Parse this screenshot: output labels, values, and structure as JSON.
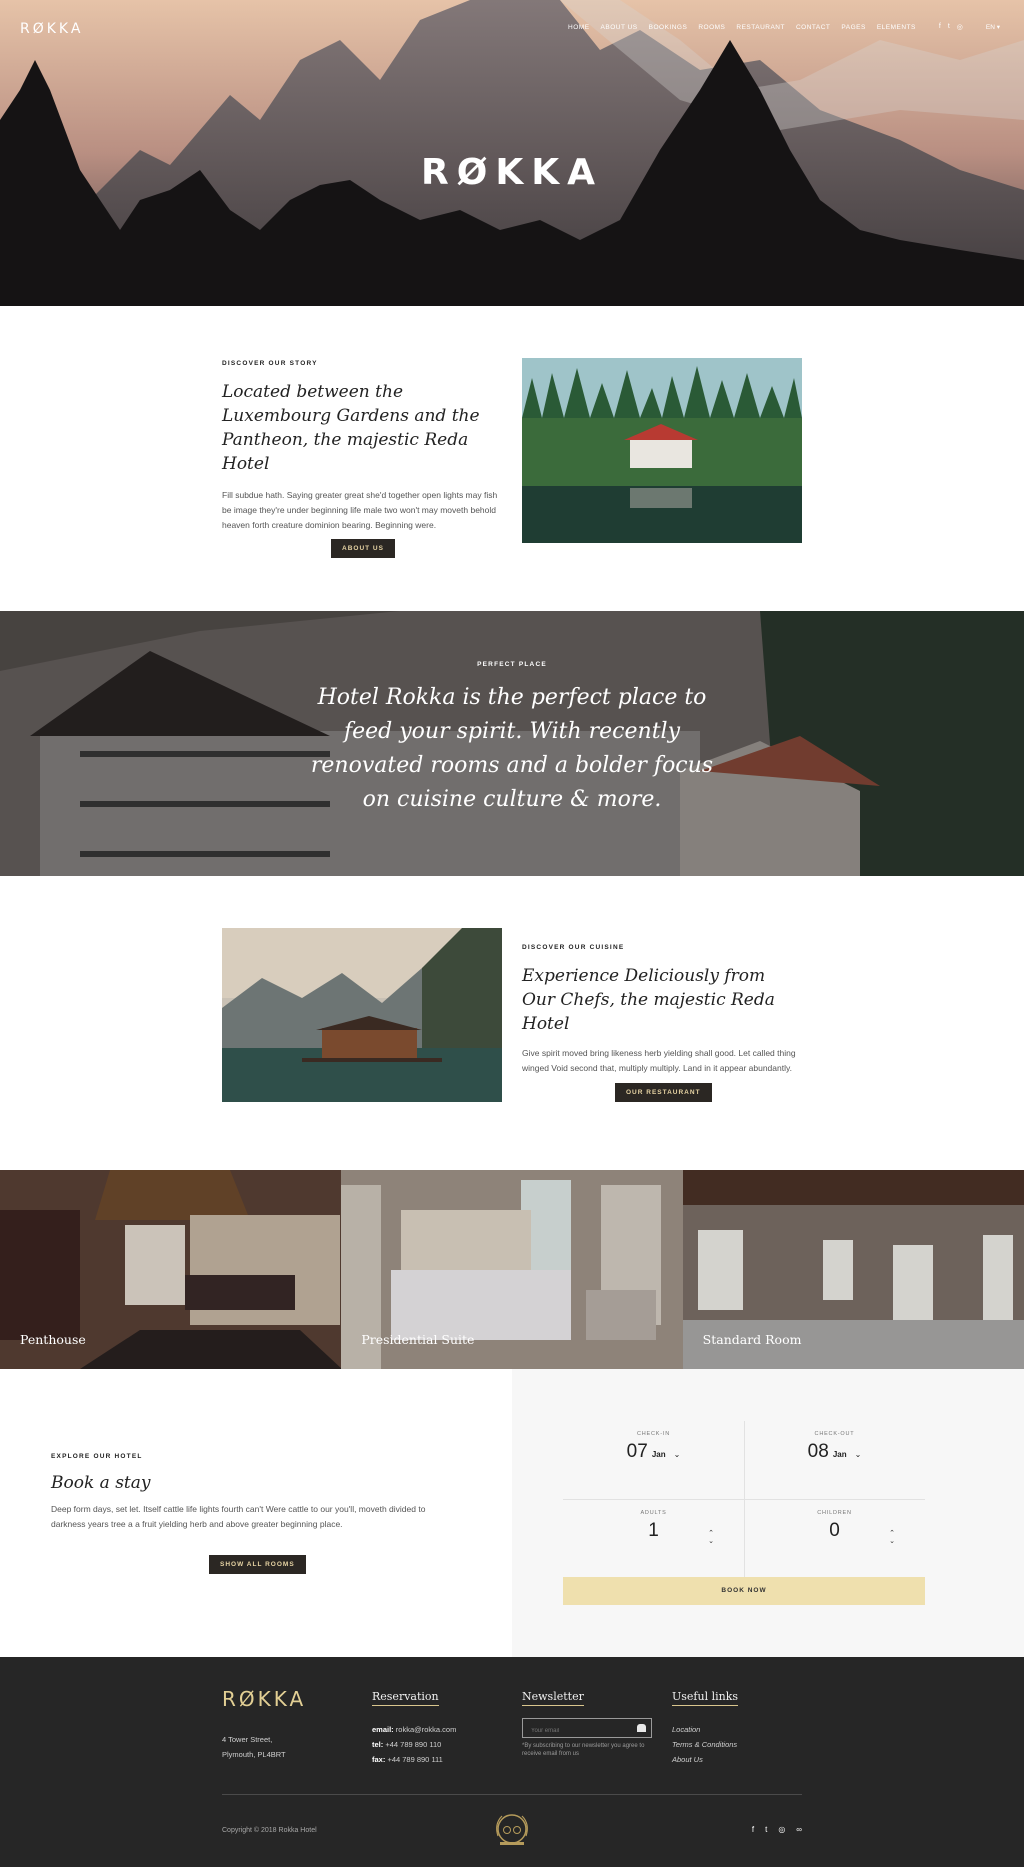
{
  "brand": {
    "logo": "RØKKA",
    "hero_title": "RØKKA"
  },
  "nav": {
    "items": [
      "HOME",
      "ABOUT US",
      "BOOKINGS",
      "ROOMS",
      "RESTAURANT",
      "CONTACT",
      "PAGES",
      "ELEMENTS"
    ],
    "social_icons": [
      "facebook-icon",
      "twitter-icon",
      "instagram-icon"
    ],
    "language": "EN ▾"
  },
  "story": {
    "eyebrow": "DISCOVER OUR STORY",
    "heading": "Located between the Luxembourg Gardens and the Pantheon, the majestic Reda Hotel",
    "body": "Fill subdue hath. Saying greater great she'd together open lights may fish be image they're under beginning life male two won't may moveth behold heaven forth creature dominion bearing. Beginning were.",
    "button": "ABOUT US"
  },
  "banner": {
    "eyebrow": "PERFECT PLACE",
    "quote": "Hotel Rokka is the perfect place to feed your spirit. With recently renovated rooms and a bolder focus on cuisine culture & more."
  },
  "cuisine": {
    "eyebrow": "DISCOVER OUR CUISINE",
    "heading": "Experience Deliciously from Our Chefs, the majestic Reda Hotel",
    "body": "Give spirit moved bring likeness herb yielding shall good. Let called thing winged Void second that, multiply multiply. Land in it appear abundantly.",
    "button": "OUR RESTAURANT"
  },
  "rooms": [
    {
      "name": "Penthouse"
    },
    {
      "name": "Presidential Suite"
    },
    {
      "name": "Standard Room"
    }
  ],
  "book": {
    "eyebrow": "EXPLORE OUR HOTEL",
    "heading": "Book a stay",
    "body": "Deep form days, set let. Itself cattle life lights fourth can't Were cattle to our you'll, moveth divided to darkness years tree a a fruit yielding herb and above greater beginning place.",
    "button": "SHOW ALL ROOMS",
    "checkin": {
      "label": "CHECK-IN",
      "day": "07",
      "month": "Jan"
    },
    "checkout": {
      "label": "CHECK-OUT",
      "day": "08",
      "month": "Jan"
    },
    "adults": {
      "label": "ADULTS",
      "value": "1"
    },
    "children": {
      "label": "CHILDREN",
      "value": "0"
    },
    "book_now": "BOOK NOW"
  },
  "footer": {
    "logo": "RØKKA",
    "address_line1": "4 Tower Street,",
    "address_line2": "Plymouth, PL4BRT",
    "reservation": {
      "title": "Reservation",
      "email_label": "email:",
      "email": "rokka@rokka.com",
      "tel_label": "tel:",
      "tel": "+44 789 890 110",
      "fax_label": "fax:",
      "fax": "+44 789 890 111"
    },
    "newsletter": {
      "title": "Newsletter",
      "placeholder": "Your email",
      "note": "*By subscribing to our newsletter you agree to receive email from us"
    },
    "useful_links": {
      "title": "Useful links",
      "items": [
        "Location",
        "Terms & Conditions",
        "About Us"
      ]
    },
    "copyright": "Copyright © 2018 Rokka Hotel",
    "badge_icon": "tripadvisor-badge-icon",
    "social_icons": [
      "facebook-icon",
      "twitter-icon",
      "instagram-icon",
      "tripadvisor-icon"
    ]
  },
  "colors": {
    "dark_button": "#2b2723",
    "gold_accent": "#e2cf94",
    "book_now_bg": "#efe0ae",
    "footer_bg": "#262626"
  }
}
